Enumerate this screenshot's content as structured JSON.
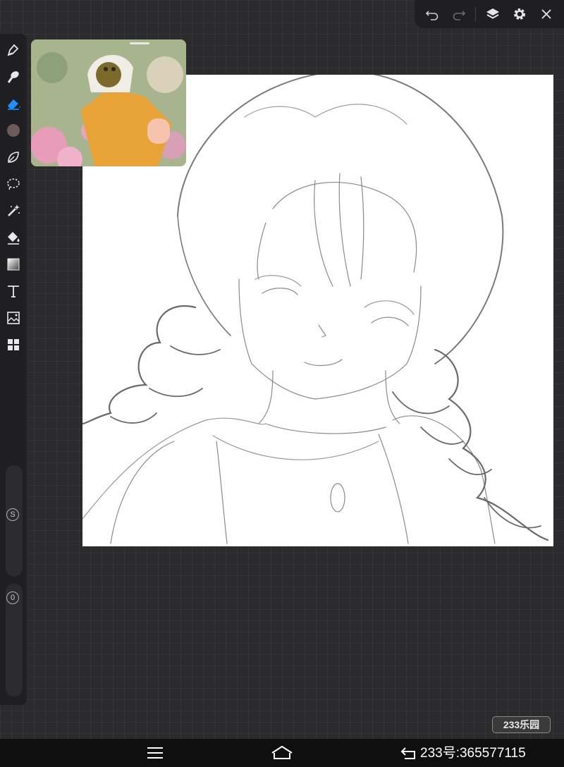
{
  "toolbar": {
    "icons": [
      "undo-icon",
      "redo-icon",
      "layers-icon",
      "settings-icon",
      "close-icon"
    ]
  },
  "tools": {
    "icons": [
      "pen-icon",
      "smudge-icon",
      "eraser-icon",
      "color-picker",
      "leaf-brush-icon",
      "lasso-icon",
      "magic-wand-icon",
      "fill-bucket-icon",
      "gradient-icon",
      "text-icon",
      "image-icon",
      "grid-icon"
    ],
    "active": "eraser-icon",
    "current_color": "#6e5a58"
  },
  "sliders": {
    "size_label": "S",
    "opacity_label": "0"
  },
  "watermark": {
    "badge_text": "233乐园"
  },
  "nav": {
    "id_text": "233号:365577115"
  },
  "colors": {
    "accent": "#1e90ff",
    "background": "#2b2b2e",
    "panel": "#1f1f22"
  }
}
